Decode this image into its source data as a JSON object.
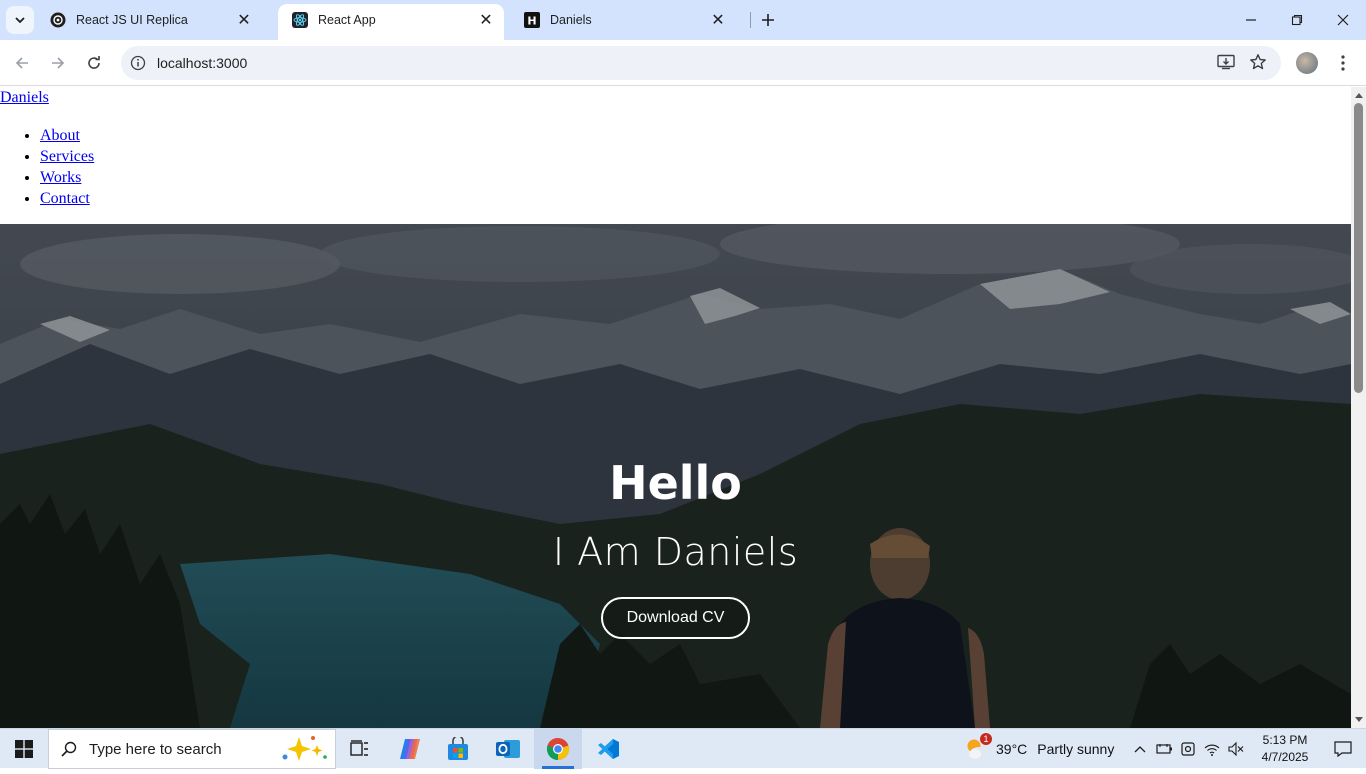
{
  "browser": {
    "tabs": [
      {
        "title": "React JS UI Replica",
        "favicon": "openai-icon",
        "active": false
      },
      {
        "title": "React App",
        "favicon": "react-icon",
        "active": true
      },
      {
        "title": "Daniels",
        "favicon": "h-logo-icon",
        "active": false
      }
    ],
    "url": "localhost:3000"
  },
  "page": {
    "brand": "Daniels",
    "nav": [
      "About",
      "Services",
      "Works",
      "Contact"
    ],
    "hero": {
      "greeting": "Hello",
      "subtitle": "I Am Daniels",
      "cta": "Download CV"
    }
  },
  "taskbar": {
    "search_placeholder": "Type here to search",
    "weather": {
      "temp": "39°C",
      "condition": "Partly sunny",
      "badge": "1"
    },
    "clock": {
      "time": "5:13 PM",
      "date": "4/7/2025"
    },
    "pinned": [
      "task-view-icon",
      "copilot-icon",
      "microsoft-store-icon",
      "outlook-icon",
      "chrome-icon",
      "vscode-icon"
    ]
  },
  "colors": {
    "tabstrip": "#d3e3fd",
    "link": "#0000ee",
    "taskbar": "#dfe9f5",
    "active_indicator": "#2a6fd6"
  }
}
